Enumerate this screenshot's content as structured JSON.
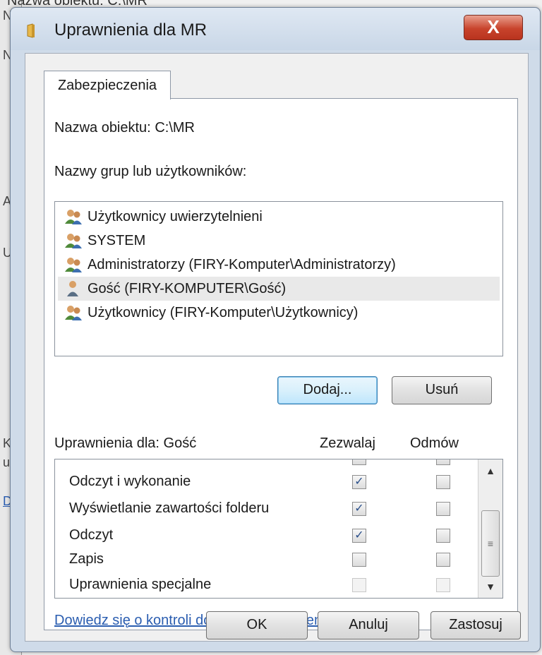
{
  "background": {
    "top_text": "Nazwa obiektu: C:\\MR",
    "letters": [
      "N",
      "N",
      "A",
      "U",
      "K",
      "u",
      "D"
    ]
  },
  "dialog": {
    "title": "Uprawnienia dla MR",
    "close_label": "X",
    "tab_label": "Zabezpieczenia",
    "object_name_label": "Nazwa obiektu:",
    "object_name_value": "C:\\MR",
    "groups_label": "Nazwy grup lub użytkowników:",
    "users": [
      {
        "name": "Użytkownicy uwierzytelnieni",
        "icon": "group-icon"
      },
      {
        "name": "SYSTEM",
        "icon": "group-icon"
      },
      {
        "name": "Administratorzy (FIRY-Komputer\\Administratorzy)",
        "icon": "group-icon"
      },
      {
        "name": "Gość (FIRY-KOMPUTER\\Gość)",
        "icon": "user-icon",
        "selected": true
      },
      {
        "name": "Użytkownicy (FIRY-Komputer\\Użytkownicy)",
        "icon": "group-icon"
      }
    ],
    "add_label": "Dodaj...",
    "remove_label": "Usuń",
    "permissions_for_label": "Uprawnienia dla: Gość",
    "allow_header": "Zezwalaj",
    "deny_header": "Odmów",
    "permissions": [
      {
        "name": "Odczyt i wykonanie",
        "allow": true,
        "deny": false,
        "allow_enabled": true,
        "deny_enabled": true
      },
      {
        "name": "Wyświetlanie zawartości folderu",
        "allow": true,
        "deny": false,
        "allow_enabled": true,
        "deny_enabled": true
      },
      {
        "name": "Odczyt",
        "allow": true,
        "deny": false,
        "allow_enabled": true,
        "deny_enabled": true
      },
      {
        "name": "Zapis",
        "allow": false,
        "deny": false,
        "allow_enabled": true,
        "deny_enabled": true
      },
      {
        "name": "Uprawnienia specjalne",
        "allow": false,
        "deny": false,
        "allow_enabled": false,
        "deny_enabled": false
      }
    ],
    "help_link": "Dowiedz się o kontroli dostępu i uprawnieniach",
    "ok_label": "OK",
    "cancel_label": "Anuluj",
    "apply_label": "Zastosuj"
  },
  "colors": {
    "close_red": "#c8432c",
    "link_blue": "#2a5db0",
    "frame": "#cfdbe9"
  }
}
